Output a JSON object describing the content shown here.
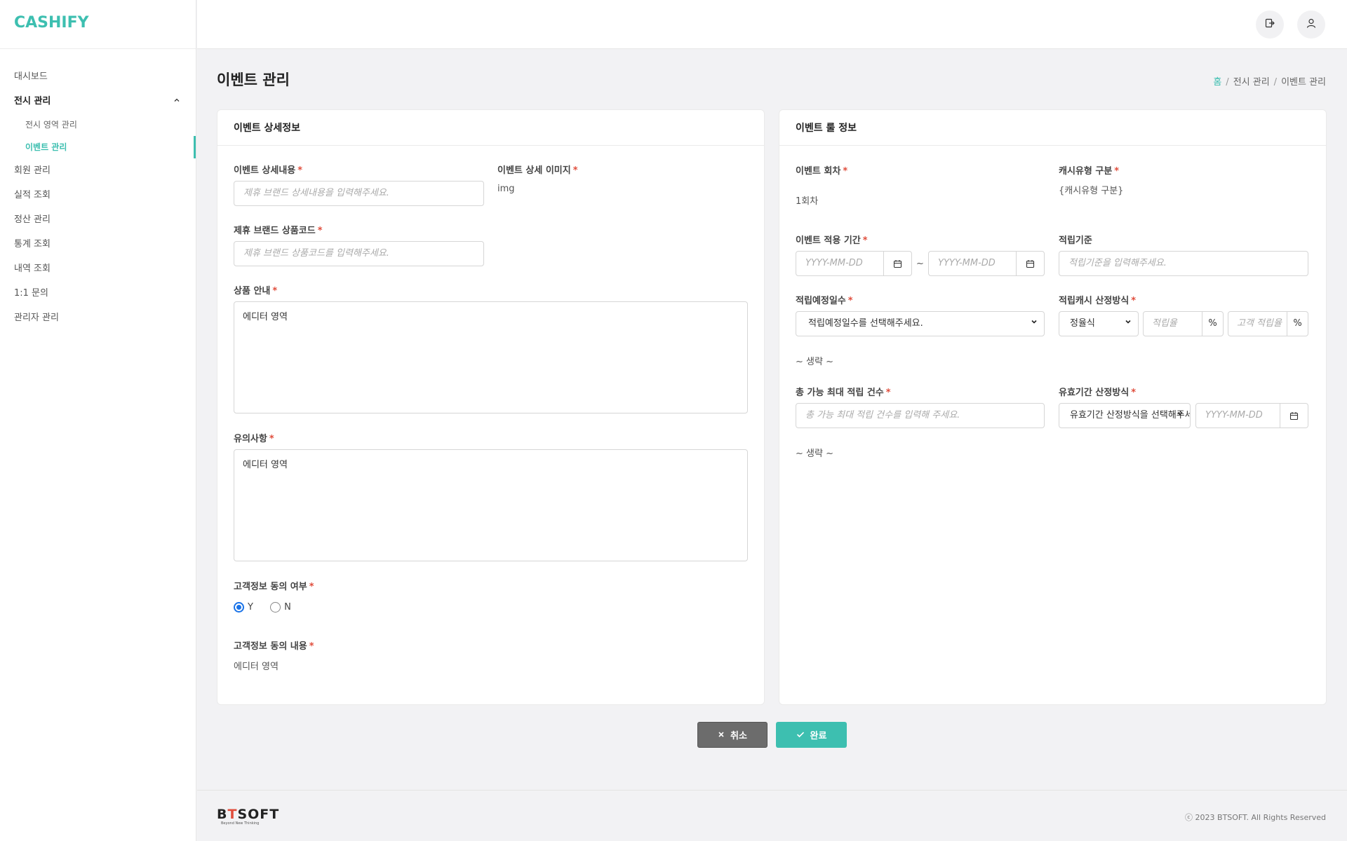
{
  "app": {
    "logo": "CASHIFY",
    "brand_color": "#3dbfb0"
  },
  "sidebar": {
    "items": [
      {
        "label": "대시보드"
      },
      {
        "label": "전시 관리",
        "expanded": true,
        "children": [
          {
            "label": "전시 영역 관리"
          },
          {
            "label": "이벤트 관리",
            "current": true
          }
        ]
      },
      {
        "label": "회원 관리"
      },
      {
        "label": "실적 조회"
      },
      {
        "label": "정산 관리"
      },
      {
        "label": "통계 조회"
      },
      {
        "label": "내역 조회"
      },
      {
        "label": "1:1 문의"
      },
      {
        "label": "관리자 관리"
      }
    ]
  },
  "header": {
    "icons": [
      "logout-icon",
      "user-icon"
    ]
  },
  "page": {
    "title": "이벤트 관리",
    "breadcrumb": {
      "home": "홈",
      "parent": "전시 관리",
      "current": "이벤트 관리"
    }
  },
  "detail": {
    "title": "이벤트 상세정보",
    "required_mark": "*",
    "desc_label": "이벤트 상세내용",
    "desc_placeholder": "제휴 브랜드 상세내용을 입력해주세요.",
    "image_label": "이벤트 상세 이미지",
    "image_value": "img",
    "code_label": "제휴 브랜드 상품코드",
    "code_placeholder": "제휴 브랜드 상품코드를 입력해주세요.",
    "guide_label": "상품 안내",
    "guide_value": "에디터 영역",
    "notice_label": "유의사항",
    "notice_value": "에디터 영역",
    "consent_label": "고객정보 동의 여부",
    "consent_yes": "Y",
    "consent_no": "N",
    "consent_selected": "Y",
    "consent_content_label": "고객정보 동의 내용",
    "consent_content_value": "에디터 영역"
  },
  "rule": {
    "title": "이벤트 룰 정보",
    "round_label": "이벤트 회차",
    "round_value": "1회차",
    "cash_type_label": "캐시유형 구분",
    "cash_type_value": "{캐시유형 구분}",
    "period_label": "이벤트 적용 기간",
    "date_placeholder": "YYYY-MM-DD",
    "tilde": "~",
    "criteria_label": "적립기준",
    "criteria_placeholder": "적립기준을 입력해주세요.",
    "days_label": "적립예정일수",
    "days_select": "적립예정일수를 선택해주세요.",
    "calc_label": "적립캐시 산정방식",
    "calc_select": "정율식",
    "rate_placeholder": "적립율",
    "customer_rate_placeholder": "고객 적립율",
    "percent": "%",
    "omit": "~ 생략 ~",
    "max_label": "총 가능 최대 적립 건수",
    "max_placeholder": "총 가능 최대 적립 건수를 입력해 주세요.",
    "valid_label": "유효기간 산정방식",
    "valid_select": "유효기간 산정방식을 선택해주세요.",
    "valid_date_placeholder": "YYYY-MM-DD"
  },
  "actions": {
    "cancel": "취소",
    "confirm": "완료"
  },
  "footer": {
    "logo_pre": "B",
    "logo_t": "T",
    "logo_post": "SOFT",
    "tagline": "Beyond New Thinking",
    "copyright": "ⓒ 2023 BTSOFT. All Rights Reserved"
  }
}
